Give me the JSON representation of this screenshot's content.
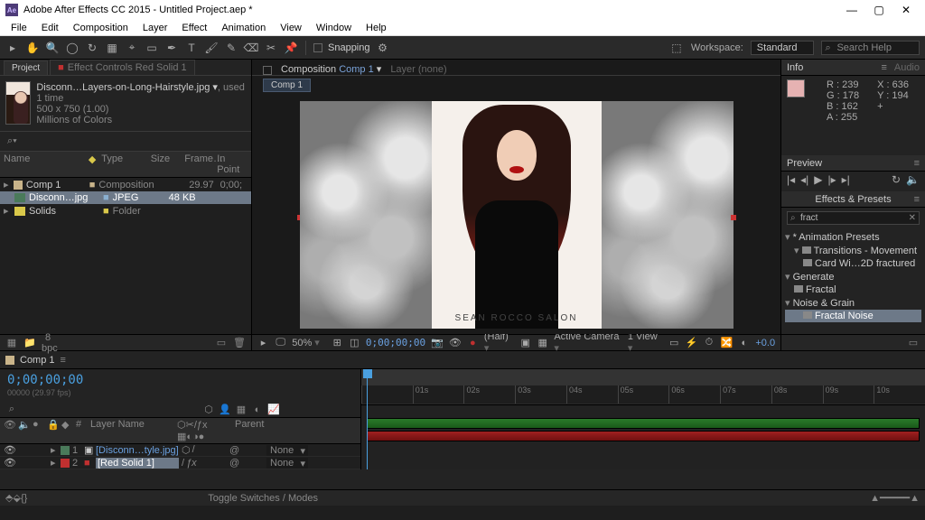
{
  "window": {
    "title": "Adobe After Effects CC 2015 - Untitled Project.aep *",
    "logo_text": "Ae"
  },
  "menu": [
    "File",
    "Edit",
    "Composition",
    "Layer",
    "Effect",
    "Animation",
    "View",
    "Window",
    "Help"
  ],
  "toolbar": {
    "snapping": "Snapping",
    "workspace_label": "Workspace:",
    "workspace_value": "Standard",
    "search_placeholder": "Search Help"
  },
  "project_panel": {
    "tabs": {
      "project": "Project",
      "effect_controls": "Effect Controls Red Solid 1"
    },
    "selected_item": {
      "name": "Disconn…Layers-on-Long-Hairstyle.jpg",
      "used": ", used 1 time",
      "dims": "500 x 750 (1.00)",
      "colors": "Millions of Colors"
    },
    "search_icon": "⌕▾",
    "columns": {
      "name": "Name",
      "type": "Type",
      "size": "Size",
      "frame": "Frame…",
      "inpoint": "In Point"
    },
    "items": [
      {
        "name": "Comp 1",
        "type": "Composition",
        "size": "",
        "frame": "29.97",
        "inpoint": "0;00;"
      },
      {
        "name": "Disconn…jpg",
        "type": "JPEG",
        "size": "48 KB",
        "frame": "",
        "inpoint": ""
      },
      {
        "name": "Solids",
        "type": "Folder",
        "size": "",
        "frame": "",
        "inpoint": ""
      }
    ],
    "footer_bpc": "8 bpc"
  },
  "comp_panel": {
    "tab_prefix": "Composition",
    "comp_link": "Comp 1",
    "layer_tab": "Layer (none)",
    "breadcrumb": "Comp 1",
    "caption": "Sean Rocco Salon",
    "footer": {
      "zoom": "50%",
      "timecode": "0;00;00;00",
      "res": "(Half)",
      "camera": "Active Camera",
      "view": "1 View",
      "exposure": "+0.0"
    }
  },
  "info_panel": {
    "title": "Info",
    "audio": "Audio",
    "R": "R : 239",
    "G": "G : 178",
    "B": "B : 162",
    "A": "A : 255",
    "X": "X : 636",
    "Y": "Y : 194",
    "plus": "+"
  },
  "preview_panel": {
    "title": "Preview"
  },
  "fx_panel": {
    "title": "Effects & Presets",
    "search": "fract",
    "tree": {
      "presets": "* Animation Presets",
      "trans": "Transitions - Movement",
      "card": "Card Wi…2D fractured",
      "gen": "Generate",
      "fractal": "Fractal",
      "noise": "Noise & Grain",
      "fnoise": "Fractal Noise"
    }
  },
  "timeline": {
    "tab": "Comp 1",
    "timecode": "0;00;00;00",
    "fps": "00000 (29.97 fps)",
    "cols": {
      "layer_name": "Layer Name",
      "parent": "Parent"
    },
    "ruler": [
      "",
      "01s",
      "02s",
      "03s",
      "04s",
      "05s",
      "06s",
      "07s",
      "08s",
      "09s",
      "10s"
    ],
    "layers": [
      {
        "num": "1",
        "name": "[Disconn…tyle.jpg]",
        "parent": "None"
      },
      {
        "num": "2",
        "name": "[Red Solid 1]",
        "parent": "None"
      }
    ],
    "footer": "Toggle Switches / Modes"
  }
}
